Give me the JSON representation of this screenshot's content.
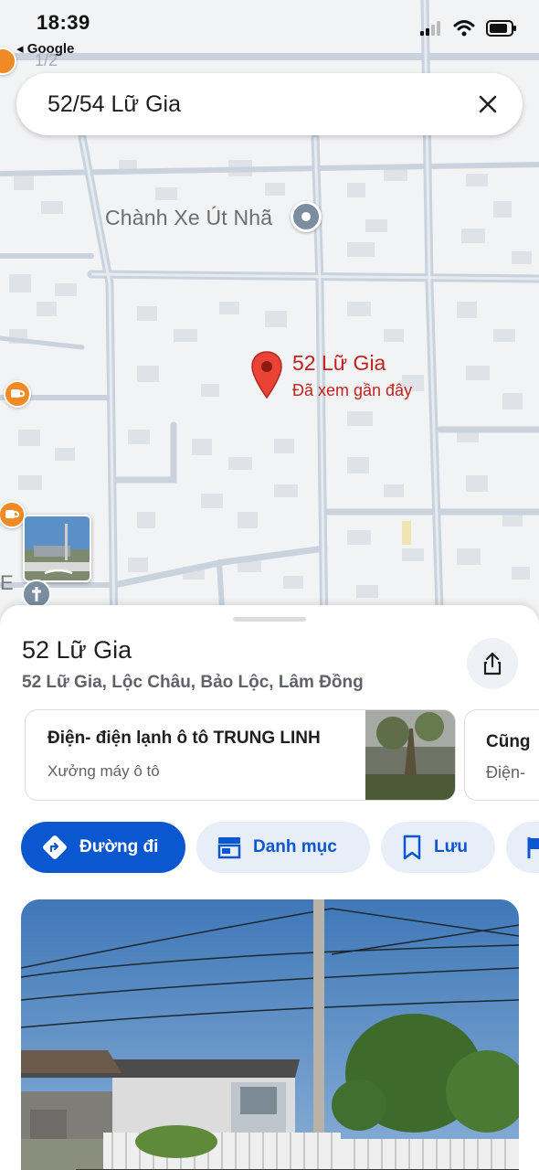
{
  "status": {
    "time": "18:39",
    "back_app": "◂ Google"
  },
  "map": {
    "page_indicator": "1/2",
    "poi_label": "Chành Xe Út Nhã",
    "pin_title": "52 Lữ Gia",
    "pin_subtitle": "Đã xem gần đây",
    "edge_letter": "E"
  },
  "search": {
    "value": "52/54 Lữ Gia",
    "clear_icon": "close-icon"
  },
  "place": {
    "title": "52 Lữ Gia",
    "address": "52 Lữ Gia, Lộc Châu, Bảo Lộc, Lâm Đồng"
  },
  "nearby_cards": [
    {
      "title": "Điện- điện lạnh ô tô TRUNG LINH",
      "subtitle": "Xưởng máy ô tô"
    },
    {
      "title": "Cũng",
      "subtitle": "Điện-"
    }
  ],
  "actions": {
    "directions": "Đường đi",
    "category": "Danh mục",
    "save": "Lưu"
  },
  "colors": {
    "accent": "#0b57d0",
    "pin_red": "#c5221f",
    "chip_bg": "#e8eef8"
  }
}
